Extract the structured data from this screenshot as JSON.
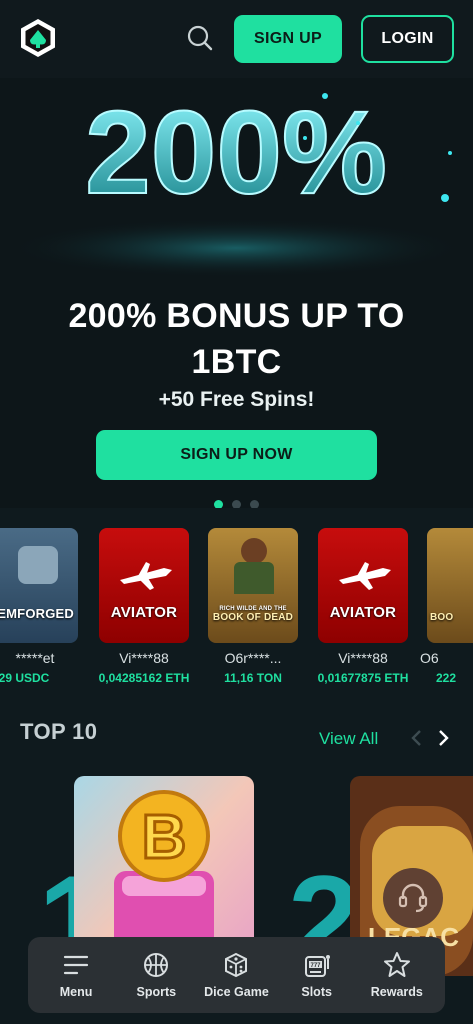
{
  "header": {
    "signup_label": "SIGN UP",
    "login_label": "LOGIN"
  },
  "hero": {
    "art_text": "200%",
    "title_line1": "200% BONUS UP TO",
    "title_line2": "1BTC",
    "subtitle": "+50 Free Spins!",
    "cta_label": "SIGN UP NOW",
    "slides": 3,
    "active_slide": 1
  },
  "recent_wins": [
    {
      "game": "EMFORGED",
      "user": "*****et",
      "amount": "29 USDC"
    },
    {
      "game": "AVIATOR",
      "user": "Vi****88",
      "amount": "0,04285162 ETH"
    },
    {
      "game": "BOOK OF DEAD",
      "game_sub": "RICH WILDE AND THE",
      "user": "O6r****...",
      "amount": "11,16 TON"
    },
    {
      "game": "AVIATOR",
      "user": "Vi****88",
      "amount": "0,01677875 ETH"
    },
    {
      "game": "BOO",
      "user": "O6",
      "amount": "222"
    }
  ],
  "top10": {
    "title": "TOP 10",
    "view_all": "View All",
    "games": [
      {
        "rank": "1",
        "tile_letter": "B"
      },
      {
        "rank": "2",
        "tile_text": "LEGAC"
      }
    ]
  },
  "bottom_nav": [
    {
      "label": "Menu",
      "icon": "menu-icon"
    },
    {
      "label": "Sports",
      "icon": "basketball-icon"
    },
    {
      "label": "Dice Game",
      "icon": "dice-icon"
    },
    {
      "label": "Slots",
      "icon": "slot-machine-icon"
    },
    {
      "label": "Rewards",
      "icon": "star-icon"
    }
  ],
  "colors": {
    "accent": "#1fe0a0",
    "background": "#0f1a1e",
    "nav_bg": "#2b3034",
    "rank_color": "#1aa8a8"
  }
}
